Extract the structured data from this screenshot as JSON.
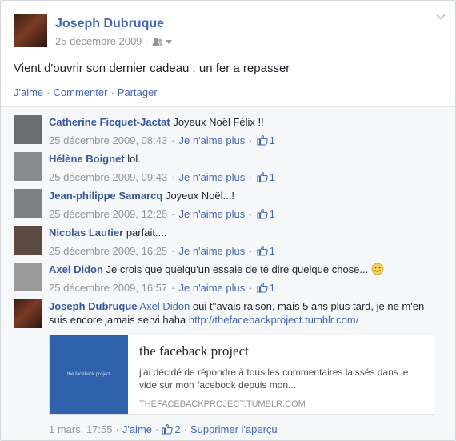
{
  "post": {
    "author": "Joseph Dubruque",
    "date": "25 décembre 2009",
    "text": "Vient d'ouvrir son dernier cadeau : un fer a repasser",
    "actions": {
      "like": "J'aime",
      "comment": "Commenter",
      "share": "Partager"
    }
  },
  "comments": [
    {
      "author": "Catherine Ficquet-Jactat",
      "text": "Joyeux Noël Félix !!",
      "date": "25 décembre 2009, 08:43",
      "unlike": "Je n'aime plus",
      "likes": "1",
      "avatar_color": "#6b6f73"
    },
    {
      "author": "Hélène Boignet",
      "text": "lol..",
      "date": "25 décembre 2009, 09:43",
      "unlike": "Je n'aime plus",
      "likes": "1",
      "avatar_color": "#8a8d90"
    },
    {
      "author": "Jean-philippe Samarcq",
      "text": "Joyeux Noël...!",
      "date": "25 décembre 2009, 12:28",
      "unlike": "Je n'aime plus",
      "likes": "1",
      "avatar_color": "#7d7f82"
    },
    {
      "author": "Nicolas Lautier",
      "text": "parfait....",
      "date": "25 décembre 2009, 16:25",
      "unlike": "Je n'aime plus",
      "likes": "1",
      "avatar_color": "#5a4a3f"
    },
    {
      "author": "Axel Didon",
      "text": "Je crois que quelqu'un essaie de te dire quelque chose...",
      "date": "25 décembre 2009, 16:57",
      "unlike": "Je n'aime plus",
      "likes": "1",
      "avatar_color": "#9a9a9a"
    }
  ],
  "last_comment": {
    "author": "Joseph Dubruque",
    "mention": "Axel Didon",
    "text": "oui t''avais raison, mais 5 ans plus tard, je ne m'en suis encore jamais servi haha",
    "url": "http://thefacebackproject.tumblr.com/",
    "date": "1 mars, 17:55",
    "like": "J'aime",
    "likes": "2",
    "remove_preview": "Supprimer l'aperçu"
  },
  "link_preview": {
    "thumb_text": "the faceback project",
    "title": "the faceback project",
    "description": "j'ai décidé de répondre à tous les commentaires laissés dans le vide sur mon facebook depuis mon...",
    "domain": "THEFACEBACKPROJECT.TUMBLR.COM"
  }
}
